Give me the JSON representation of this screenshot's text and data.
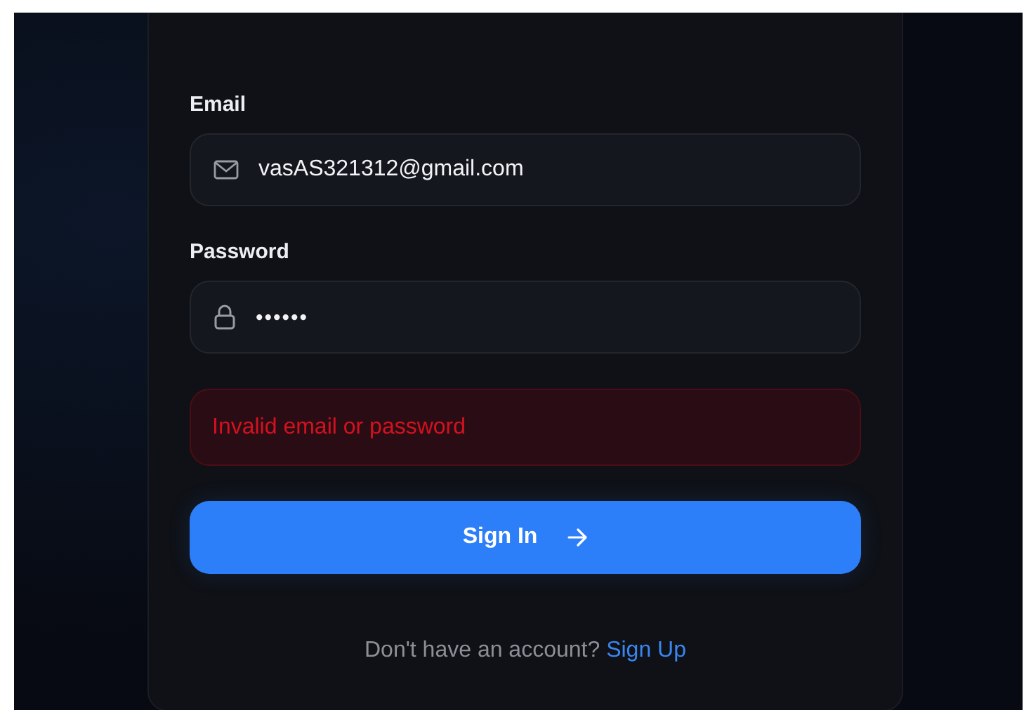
{
  "form": {
    "fields": [
      {
        "kind": "email",
        "label": "Email",
        "value": "vasAS321312@gmail.com"
      },
      {
        "kind": "password",
        "label": "Password",
        "value": "••••••"
      }
    ],
    "error": "Invalid email or password",
    "submit": "Sign In",
    "footer": {
      "text": "Don't have an account?",
      "link": "Sign Up"
    }
  }
}
